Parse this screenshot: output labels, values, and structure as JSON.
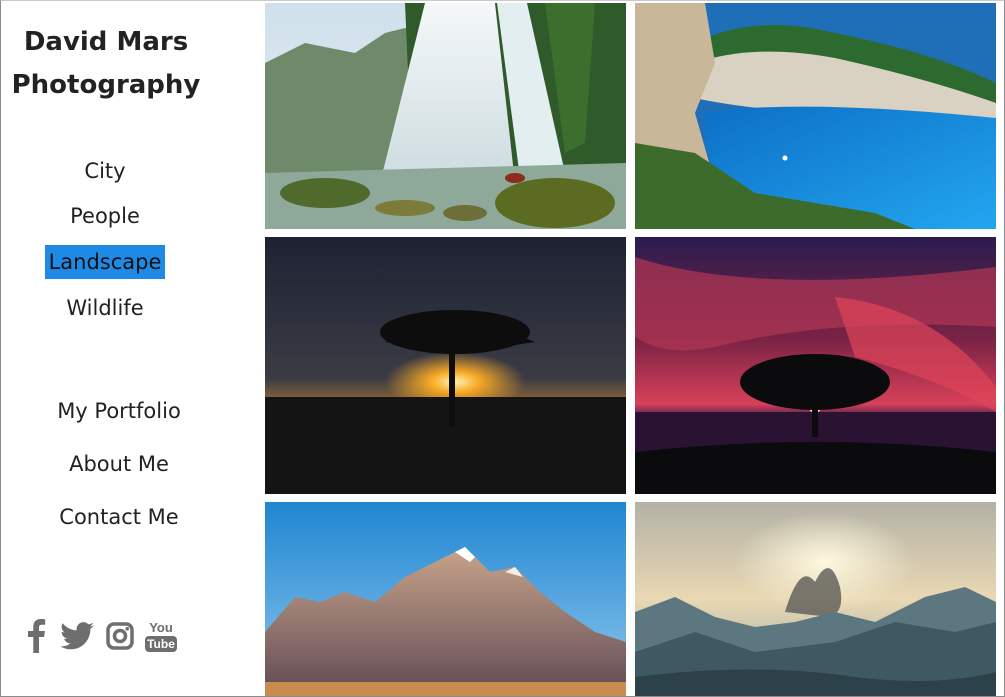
{
  "brand": {
    "line1": "David Mars",
    "line2": "Photography"
  },
  "categories": [
    {
      "label": "City",
      "active": false
    },
    {
      "label": "People",
      "active": false
    },
    {
      "label": "Landscape",
      "active": true
    },
    {
      "label": "Wildlife",
      "active": false
    }
  ],
  "pages": [
    {
      "label": "My Portfolio"
    },
    {
      "label": "About Me"
    },
    {
      "label": "Contact Me"
    }
  ],
  "social": [
    {
      "icon": "facebook-icon"
    },
    {
      "icon": "twitter-icon"
    },
    {
      "icon": "instagram-icon"
    },
    {
      "icon": "youtube-icon",
      "text_top": "You",
      "text_bottom": "Tube"
    }
  ],
  "gallery": [
    {
      "subject": "waterfall"
    },
    {
      "subject": "coastal-bay"
    },
    {
      "subject": "acacia-sunset"
    },
    {
      "subject": "tree-red-sky"
    },
    {
      "subject": "mountain-peaks"
    },
    {
      "subject": "misty-valley"
    }
  ],
  "colors": {
    "active_highlight": "#1e8ae6",
    "icon_gray": "#6e6e6e",
    "text": "#222222"
  }
}
